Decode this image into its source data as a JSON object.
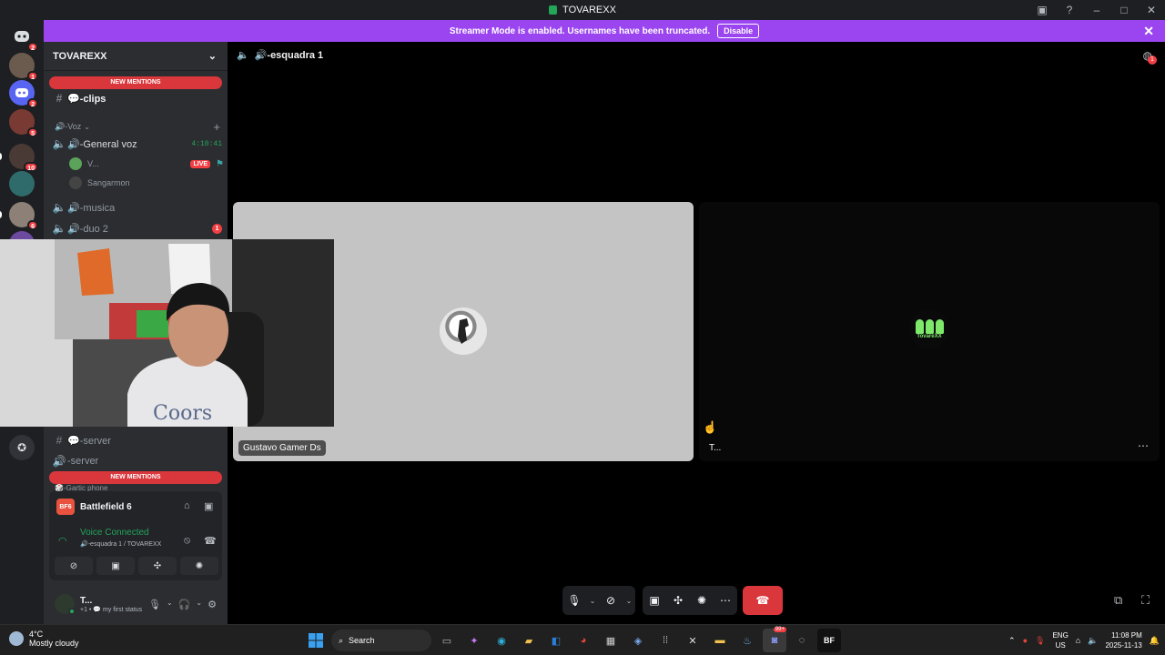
{
  "window": {
    "title": "TOVAREXX"
  },
  "banner": {
    "message": "Streamer Mode is enabled. Usernames have been truncated.",
    "disable_label": "Disable"
  },
  "rail": {
    "servers": [
      {
        "name": "home",
        "badge": "2",
        "color": "#5865f2"
      },
      {
        "name": "dm-1",
        "badge": "1",
        "color": "#6b5a4e"
      },
      {
        "name": "dm-2",
        "badge": "2",
        "color": "#5865f2"
      },
      {
        "name": "server-a",
        "badge": "5",
        "color": "#7a3a34"
      },
      {
        "name": "server-b",
        "badge": "10",
        "color": "#4a3a36"
      },
      {
        "name": "server-c",
        "badge": "",
        "color": "#2f6b6a"
      },
      {
        "name": "server-d",
        "badge": "6",
        "color": "#8d8177"
      },
      {
        "name": "server-e",
        "badge": "",
        "color": "#6b4aa0"
      }
    ]
  },
  "sidebar": {
    "guild_name": "TOVAREXX",
    "new_mentions_label": "NEW MENTIONS",
    "channels_top": [
      {
        "prefix": "#",
        "label": "💬-clips",
        "active": true
      }
    ],
    "voice_category": "🔊-Voz",
    "voice_channels": [
      {
        "label": "🔊-General voz",
        "timer": "4:10:41"
      },
      {
        "label": "🔊-musica"
      },
      {
        "label": "🔊-duo 2",
        "badge": "1"
      }
    ],
    "voice_users": [
      {
        "name": "V...",
        "live": "LIVE"
      },
      {
        "name": "Sangarmon"
      }
    ],
    "channels_bottom": [
      {
        "prefix": "#",
        "label": "💬-server"
      },
      {
        "prefix": "🔊",
        "label": "-server"
      }
    ],
    "bottom_category": "🎲-Gartic phone"
  },
  "activity": {
    "game": "Battlefield 6",
    "game_logo_text": "BF6"
  },
  "voice_panel": {
    "status": "Voice Connected",
    "channel": "🔊-esquadra 1 / TOVAREXX"
  },
  "user": {
    "name": "T...",
    "status": "+1 • 💬 my first status"
  },
  "main": {
    "channel_name": "🔊-esquadra 1",
    "inbox_badge": "1",
    "tiles": [
      {
        "label": "Gustavo Gamer Ds"
      },
      {
        "label": "T..."
      }
    ],
    "tile2_logo_text": "TovareXX"
  },
  "taskbar": {
    "weather_temp": "4°C",
    "weather_desc": "Mostly cloudy",
    "search_placeholder": "Search",
    "lang": "ENG",
    "region": "US",
    "time": "11:08 PM",
    "date": "2025-11-13",
    "steam_badge": "99+"
  },
  "colors": {
    "banner": "#9b45f0",
    "hangup": "#da373c",
    "connected": "#23a55a",
    "mention": "#da373c"
  }
}
